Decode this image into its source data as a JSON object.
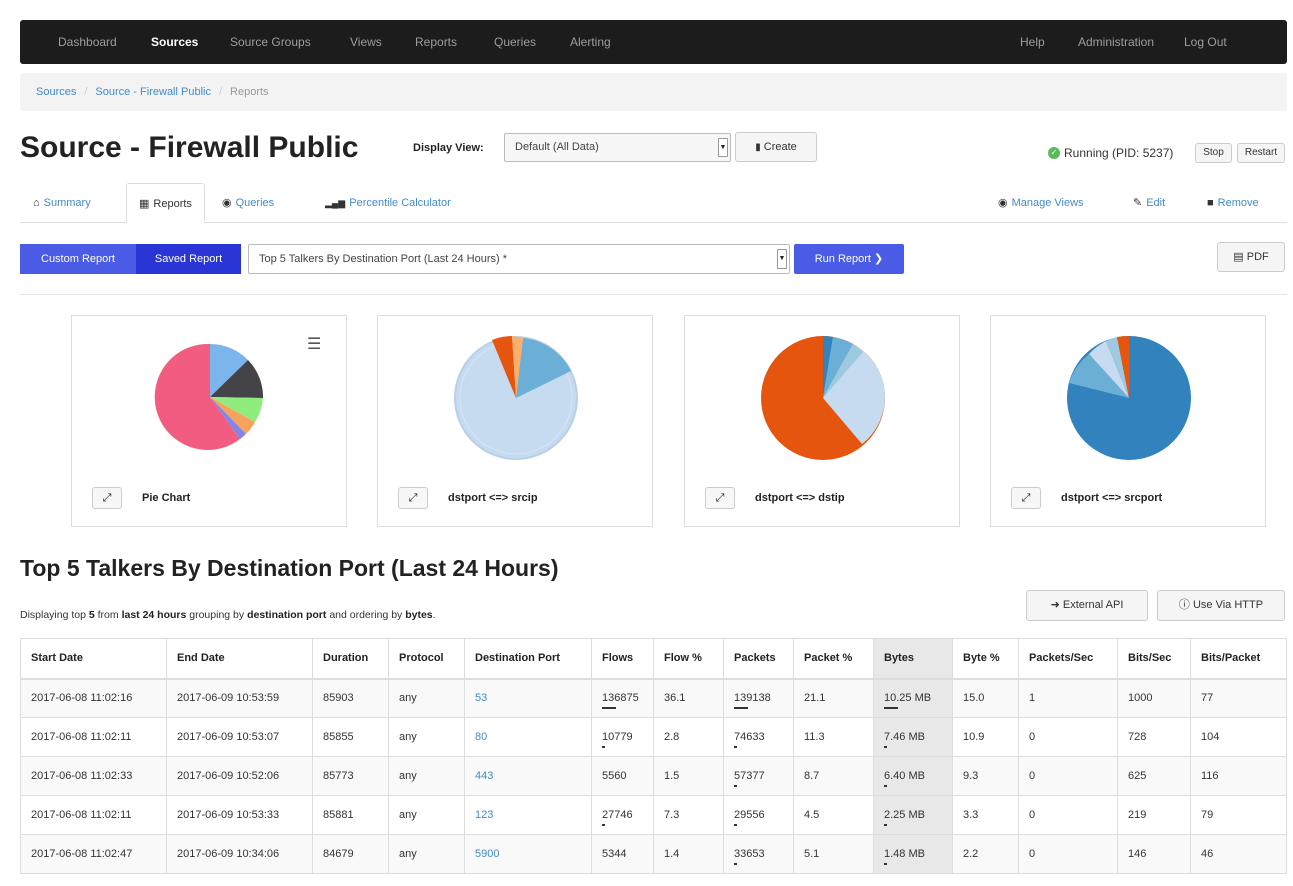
{
  "nav": {
    "left": [
      "Dashboard",
      "Sources",
      "Source Groups",
      "Views",
      "Reports",
      "Queries",
      "Alerting"
    ],
    "active": "Sources",
    "right": [
      "Help",
      "Administration",
      "Log Out"
    ]
  },
  "breadcrumb": [
    "Sources",
    "Source - Firewall Public",
    "Reports"
  ],
  "page": {
    "title": "Source - Firewall Public",
    "display_view_label": "Display View:",
    "display_view_value": "Default (All Data)",
    "create_label": "Create",
    "status": "Running (PID: 5237)",
    "stop_label": "Stop",
    "restart_label": "Restart"
  },
  "tabs": {
    "summary": "Summary",
    "reports": "Reports",
    "queries": "Queries",
    "percentile": "Percentile Calculator",
    "manage_views": "Manage Views",
    "edit": "Edit",
    "remove": "Remove"
  },
  "report_bar": {
    "custom": "Custom Report",
    "saved": "Saved Report",
    "selected_report": "Top 5 Talkers By Destination Port (Last 24 Hours) *",
    "run": "Run Report",
    "pdf": "PDF"
  },
  "cards": [
    {
      "label": "Pie Chart"
    },
    {
      "label": "dstport <=> srcip"
    },
    {
      "label": "dstport <=> dstip"
    },
    {
      "label": "dstport <=> srcport"
    }
  ],
  "report": {
    "title": "Top 5 Talkers By Destination Port (Last 24 Hours)",
    "desc_1": "Displaying top ",
    "desc_n": "5",
    "desc_2": " from ",
    "desc_range": "last 24 hours",
    "desc_3": " grouping by ",
    "desc_group": "destination port",
    "desc_4": " and ordering by ",
    "desc_order": "bytes",
    "desc_5": ".",
    "external_api": "External API",
    "use_http": "Use Via HTTP"
  },
  "table": {
    "headers": [
      "Start Date",
      "End Date",
      "Duration",
      "Protocol",
      "Destination Port",
      "Flows",
      "Flow %",
      "Packets",
      "Packet %",
      "Bytes",
      "Byte %",
      "Packets/Sec",
      "Bits/Sec",
      "Bits/Packet"
    ],
    "rows": [
      [
        "2017-06-08 11:02:16",
        "2017-06-09 10:53:59",
        "85903",
        "any",
        "53",
        "136875",
        "36.1",
        "139138",
        "21.1",
        "10.25 MB",
        "15.0",
        "1",
        "1000",
        "77"
      ],
      [
        "2017-06-08 11:02:11",
        "2017-06-09 10:53:07",
        "85855",
        "any",
        "80",
        "10779",
        "2.8",
        "74633",
        "11.3",
        "7.46 MB",
        "10.9",
        "0",
        "728",
        "104"
      ],
      [
        "2017-06-08 11:02:33",
        "2017-06-09 10:52:06",
        "85773",
        "any",
        "443",
        "5560",
        "1.5",
        "57377",
        "8.7",
        "6.40 MB",
        "9.3",
        "0",
        "625",
        "116"
      ],
      [
        "2017-06-08 11:02:11",
        "2017-06-09 10:53:33",
        "85881",
        "any",
        "123",
        "27746",
        "7.3",
        "29556",
        "4.5",
        "2.25 MB",
        "3.3",
        "0",
        "219",
        "79"
      ],
      [
        "2017-06-08 11:02:47",
        "2017-06-09 10:34:06",
        "84679",
        "any",
        "5900",
        "5344",
        "1.4",
        "33653",
        "5.1",
        "1.48 MB",
        "2.2",
        "0",
        "146",
        "46"
      ]
    ]
  },
  "colors": {
    "primary": "#4a5be6",
    "link": "#428bca",
    "running": "#5cb85c"
  }
}
